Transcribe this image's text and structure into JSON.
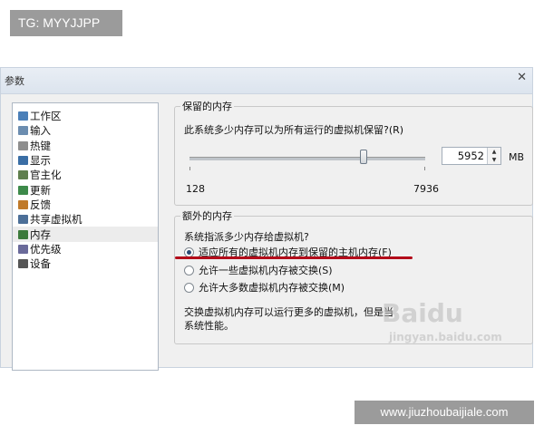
{
  "top_tag": "TG: MYYJJPP",
  "bottom_tag": "www.jiuzhoubaijiale.com",
  "window": {
    "title": "参数",
    "close_glyph": "✕"
  },
  "tree": {
    "items": [
      {
        "label": "工作区",
        "icon_color": "#4a7fb8",
        "selected": false
      },
      {
        "label": "输入",
        "icon_color": "#6c8db0",
        "selected": false
      },
      {
        "label": "热键",
        "icon_color": "#8e8e8e",
        "selected": false
      },
      {
        "label": "显示",
        "icon_color": "#3a6ea5",
        "selected": false
      },
      {
        "label": "官主化",
        "icon_color": "#5f7f4e",
        "selected": false
      },
      {
        "label": "更新",
        "icon_color": "#3d8a4a",
        "selected": false
      },
      {
        "label": "反馈",
        "icon_color": "#c07a2a",
        "selected": false
      },
      {
        "label": "共享虚拟机",
        "icon_color": "#4c6f98",
        "selected": false
      },
      {
        "label": "内存",
        "icon_color": "#3c7a3c",
        "selected": true
      },
      {
        "label": "优先级",
        "icon_color": "#6a6a9a",
        "selected": false
      },
      {
        "label": "设备",
        "icon_color": "#555555",
        "selected": false
      }
    ]
  },
  "reserved_memory": {
    "group_label": "保留的内存",
    "question": "此系统多少内存可以为所有运行的虚拟机保留?(R)",
    "slider_min_label": "128",
    "slider_max_label": "7936",
    "value": "5952",
    "unit": "MB",
    "spin_up": "▲",
    "spin_down": "▼"
  },
  "extra_memory": {
    "group_label": "额外的内存",
    "question": "系统指派多少内存给虚拟机?",
    "options": [
      {
        "label": "适应所有的虚拟机内存到保留的主机内存(F)",
        "checked": true
      },
      {
        "label": "允许一些虚拟机内存被交换(S)",
        "checked": false
      },
      {
        "label": "允许大多数虚拟机内存被交换(M)",
        "checked": false
      }
    ],
    "description_line1": "交换虚拟机内存可以运行更多的虚拟机，但是当",
    "description_line2": "系统性能。"
  },
  "watermark": {
    "brand": "Baidu",
    "sub": "jingyan.baidu.com"
  },
  "colors": {
    "highlight_underline": "#b30c1a",
    "tag_bg": "#9b9b9b"
  }
}
